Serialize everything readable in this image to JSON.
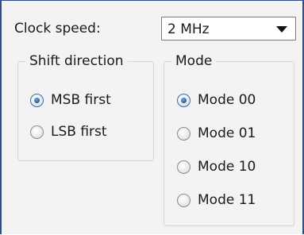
{
  "clock_speed": {
    "label": "Clock speed:",
    "selected_value": "2 MHz"
  },
  "shift_direction": {
    "title": "Shift direction",
    "options": [
      {
        "label": "MSB first",
        "checked": true
      },
      {
        "label": "LSB first",
        "checked": false
      }
    ]
  },
  "mode": {
    "title": "Mode",
    "options": [
      {
        "label": "Mode 00",
        "checked": true
      },
      {
        "label": "Mode 01",
        "checked": false
      },
      {
        "label": "Mode 10",
        "checked": false
      },
      {
        "label": "Mode 11",
        "checked": false
      }
    ]
  },
  "colors": {
    "accent": "#2e4f8a",
    "panel_background": "#f3f3f3",
    "radio_selected": "#2059a8"
  },
  "icons": {
    "dropdown": "chevron-down-icon"
  }
}
